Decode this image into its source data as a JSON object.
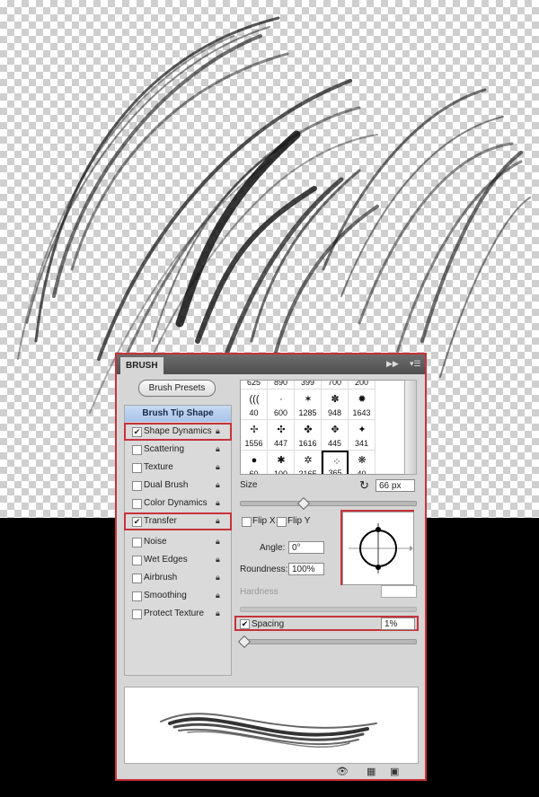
{
  "panel": {
    "tab": "BRUSH",
    "presets_button": "Brush Presets",
    "section_header": "Brush Tip Shape",
    "options": [
      {
        "label": "Shape Dynamics",
        "checked": true
      },
      {
        "label": "Scattering",
        "checked": false
      },
      {
        "label": "Texture",
        "checked": false
      },
      {
        "label": "Dual Brush",
        "checked": false
      },
      {
        "label": "Color Dynamics",
        "checked": false
      },
      {
        "label": "Transfer",
        "checked": true
      },
      {
        "label": "Noise",
        "checked": false
      },
      {
        "label": "Wet Edges",
        "checked": false
      },
      {
        "label": "Airbrush",
        "checked": false
      },
      {
        "label": "Smoothing",
        "checked": false
      },
      {
        "label": "Protect Texture",
        "checked": false
      }
    ],
    "brush_grid": {
      "top_partial": [
        "625",
        "890",
        "399",
        "700",
        "200"
      ],
      "row1": [
        "40",
        "600",
        "1285",
        "948",
        "1643"
      ],
      "row2": [
        "1556",
        "447",
        "1616",
        "445",
        "341"
      ],
      "row3": [
        "60",
        "100",
        "2165",
        "365",
        "40"
      ],
      "selected": "365"
    },
    "size_label": "Size",
    "size_value": "66 px",
    "size_slider_fraction": 0.36,
    "flip_x_label": "Flip X",
    "flip_y_label": "Flip Y",
    "angle_label": "Angle:",
    "angle_value": "0°",
    "roundness_label": "Roundness:",
    "roundness_value": "100%",
    "hardness_label": "Hardness",
    "spacing_label": "Spacing",
    "spacing_checked": true,
    "spacing_value": "1%",
    "spacing_slider_fraction": 0.0
  },
  "colors": {
    "highlight": "#c8323a",
    "panel_bg": "#d6d6d6",
    "title_bg": "#555555"
  },
  "icons": [
    "expand-icon",
    "menu-icon",
    "reset-icon",
    "lock-icon",
    "eye-icon",
    "grid-icon",
    "new-preset-icon"
  ]
}
